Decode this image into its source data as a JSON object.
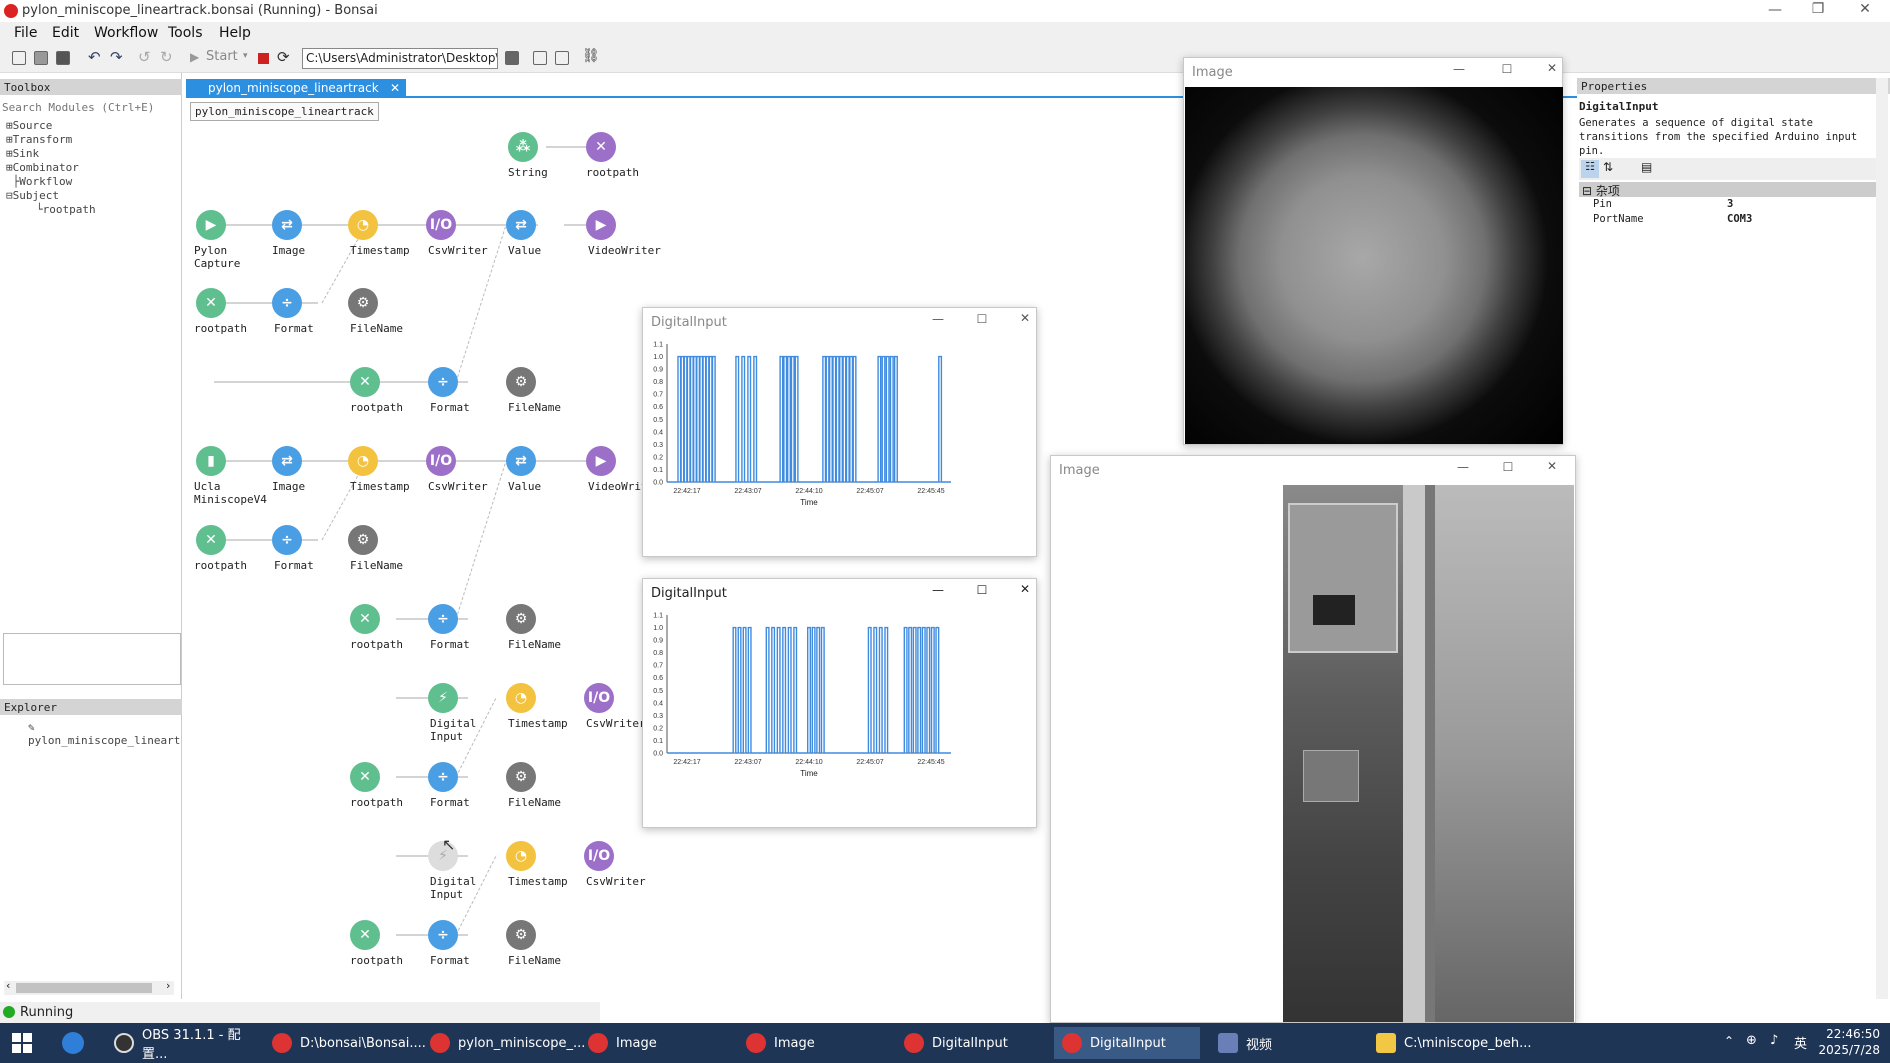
{
  "window": {
    "title": "pylon_miniscope_lineartrack.bonsai (Running) - Bonsai"
  },
  "menu": [
    "File",
    "Edit",
    "Workflow",
    "Tools",
    "Help"
  ],
  "toolbar": {
    "start_label": "Start",
    "path_value": "C:\\Users\\Administrator\\Desktop\\p"
  },
  "toolbox": {
    "header": "Toolbox",
    "search_placeholder": "Search Modules (Ctrl+E)",
    "items": [
      "Source",
      "Transform",
      "Sink",
      "Combinator",
      "Workflow",
      "Subject"
    ],
    "subject_child": "rootpath"
  },
  "explorer": {
    "header": "Explorer",
    "item": "pylon_miniscope_lineart"
  },
  "status": {
    "text": "Running"
  },
  "editor": {
    "tab": "pylon_miniscope_lineartrack",
    "breadcrumb": "pylon_miniscope_lineartrack",
    "nodes": [
      {
        "label": "String",
        "icon": "string-icon",
        "color": "green"
      },
      {
        "label": "rootpath",
        "icon": "subject-icon",
        "color": "purple"
      },
      {
        "label": "Pylon Capture",
        "icon": "camera-icon",
        "color": "green"
      },
      {
        "label": "Image",
        "icon": "shuffle-icon",
        "color": "blue"
      },
      {
        "label": "Timestamp",
        "icon": "clock-icon",
        "color": "yellow"
      },
      {
        "label": "CsvWriter",
        "icon": "io-icon",
        "color": "purple"
      },
      {
        "label": "Value",
        "icon": "shuffle-icon",
        "color": "blue"
      },
      {
        "label": "VideoWriter",
        "icon": "camera-icon",
        "color": "purple"
      },
      {
        "label": "rootpath",
        "icon": "subject-icon",
        "color": "green"
      },
      {
        "label": "Format",
        "icon": "calc-icon",
        "color": "blue"
      },
      {
        "label": "FileName",
        "icon": "gear-icon",
        "color": "gray"
      },
      {
        "label": "rootpath",
        "icon": "subject-icon",
        "color": "green"
      },
      {
        "label": "Format",
        "icon": "calc-icon",
        "color": "blue"
      },
      {
        "label": "FileName",
        "icon": "gear-icon",
        "color": "gray"
      },
      {
        "label": "Ucla MiniscopeV4",
        "icon": "miniscope-icon",
        "color": "green"
      },
      {
        "label": "Image",
        "icon": "shuffle-icon",
        "color": "blue"
      },
      {
        "label": "Timestamp",
        "icon": "clock-icon",
        "color": "yellow"
      },
      {
        "label": "CsvWriter",
        "icon": "io-icon",
        "color": "purple"
      },
      {
        "label": "Value",
        "icon": "shuffle-icon",
        "color": "blue"
      },
      {
        "label": "VideoWrit",
        "icon": "camera-icon",
        "color": "purple"
      },
      {
        "label": "rootpath",
        "icon": "subject-icon",
        "color": "green"
      },
      {
        "label": "Format",
        "icon": "calc-icon",
        "color": "blue"
      },
      {
        "label": "FileName",
        "icon": "gear-icon",
        "color": "gray"
      },
      {
        "label": "rootpath",
        "icon": "subject-icon",
        "color": "green"
      },
      {
        "label": "Format",
        "icon": "calc-icon",
        "color": "blue"
      },
      {
        "label": "FileName",
        "icon": "gear-icon",
        "color": "gray"
      },
      {
        "label": "Digital Input",
        "icon": "bolt-icon",
        "color": "green"
      },
      {
        "label": "Timestamp",
        "icon": "clock-icon",
        "color": "yellow"
      },
      {
        "label": "CsvWriter",
        "icon": "io-icon",
        "color": "purple"
      },
      {
        "label": "rootpath",
        "icon": "subject-icon",
        "color": "green"
      },
      {
        "label": "Format",
        "icon": "calc-icon",
        "color": "blue"
      },
      {
        "label": "FileName",
        "icon": "gear-icon",
        "color": "gray"
      },
      {
        "label": "Digital Input",
        "icon": "bolt-icon",
        "color": "ghost"
      },
      {
        "label": "Timestamp",
        "icon": "clock-icon",
        "color": "yellow"
      },
      {
        "label": "CsvWriter",
        "icon": "io-icon",
        "color": "purple"
      },
      {
        "label": "rootpath",
        "icon": "subject-icon",
        "color": "green"
      },
      {
        "label": "Format",
        "icon": "calc-icon",
        "color": "blue"
      },
      {
        "label": "FileName",
        "icon": "gear-icon",
        "color": "gray"
      }
    ]
  },
  "properties": {
    "header": "Properties",
    "title": "DigitalInput",
    "description": "Generates a sequence of digital state transitions from the specified Arduino input pin.",
    "category": "杂项",
    "rows": [
      {
        "name": "Pin",
        "value": "3"
      },
      {
        "name": "PortName",
        "value": "COM3"
      }
    ]
  },
  "image_window_1": {
    "title": "Image"
  },
  "image_window_2": {
    "title": "Image"
  },
  "digital_windows": [
    {
      "title": "DigitalInput"
    },
    {
      "title": "DigitalInput"
    }
  ],
  "chart_data": [
    {
      "type": "line",
      "title": "",
      "xlabel": "Time",
      "ylabel": "",
      "ylim": [
        0,
        1.1
      ],
      "yticks": [
        "1.1",
        "1.0",
        "0.9",
        "0.8",
        "0.7",
        "0.6",
        "0.5",
        "0.4",
        "0.3",
        "0.2",
        "0.1",
        "0.0"
      ],
      "xticks": [
        "22:42:17",
        "22:43:07",
        "22:44:10",
        "22:45:07",
        "22:45:45"
      ],
      "pulse_groups": [
        [
          0.03,
          0.155,
          12
        ],
        [
          0.24,
          0.305,
          4
        ],
        [
          0.4,
          0.455,
          5
        ],
        [
          0.555,
          0.665,
          10
        ],
        [
          0.755,
          0.815,
          5
        ],
        [
          0.975,
          0.985,
          1
        ]
      ]
    },
    {
      "type": "line",
      "title": "",
      "xlabel": "Time",
      "ylabel": "",
      "ylim": [
        0,
        1.1
      ],
      "yticks": [
        "1.1",
        "1.0",
        "0.9",
        "0.8",
        "0.7",
        "0.6",
        "0.5",
        "0.4",
        "0.3",
        "0.2",
        "0.1",
        "0.0"
      ],
      "xticks": [
        "22:42:17",
        "22:43:07",
        "22:44:10",
        "22:45:07",
        "22:45:45"
      ],
      "pulse_groups": [
        [
          0.23,
          0.285,
          4
        ],
        [
          0.35,
          0.45,
          6
        ],
        [
          0.5,
          0.55,
          4
        ],
        [
          0.72,
          0.78,
          4
        ],
        [
          0.85,
          0.965,
          8
        ]
      ]
    }
  ],
  "taskbar": {
    "items": [
      "OBS 31.1.1 - 配置...",
      "D:\\bonsai\\Bonsai....",
      "pylon_miniscope_...",
      "Image",
      "Image",
      "DigitalInput",
      "DigitalInput",
      "视频",
      "C:\\miniscope_beh..."
    ],
    "ime": "英",
    "time": "22:46:50",
    "date": "2025/7/28"
  }
}
